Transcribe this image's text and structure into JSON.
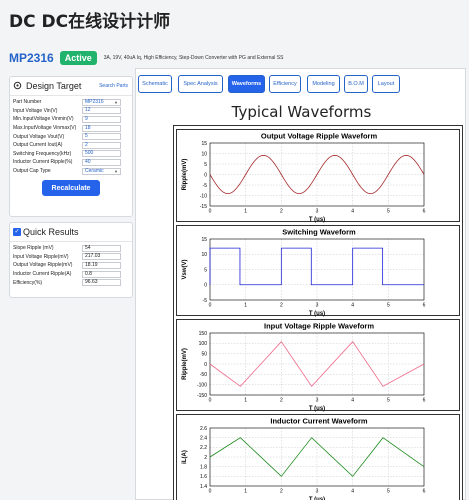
{
  "header": {
    "title": "DC DC在线设计计师"
  },
  "part": {
    "name": "MP2316",
    "status": "Active",
    "description": "3A, 19V, 40uA Iq, High Efficiency, Step-Down Converter with PG and External SS"
  },
  "design_target": {
    "title": "Design Target",
    "link": "Search Parts",
    "fields": [
      {
        "label": "Part Number",
        "value": "MP2316",
        "type": "select"
      },
      {
        "label": "Input Voltage Vin(V)",
        "value": "12",
        "type": "input"
      },
      {
        "label": "Min.InputVoltage Vinmin(V)",
        "value": "9",
        "type": "input"
      },
      {
        "label": "Max.InputVoltage Vinmax(V)",
        "value": "18",
        "type": "input"
      },
      {
        "label": "Output Voltage Vout(V)",
        "value": "5",
        "type": "input"
      },
      {
        "label": "Output Current Iout(A)",
        "value": "2",
        "type": "input"
      },
      {
        "label": "Switching Frequency(kHz)",
        "value": "500",
        "type": "input"
      },
      {
        "label": "Inductor Current Ripple(%)",
        "value": "40",
        "type": "input"
      },
      {
        "label": "Output Cap Type",
        "value": "Ceramic",
        "type": "select"
      }
    ],
    "button": "Recalculate"
  },
  "quick_results": {
    "title": "Quick Results",
    "checked": true,
    "fields": [
      {
        "label": "Slope Ripple (mV)",
        "value": "54"
      },
      {
        "label": "Input Voltage Ripple(mV)",
        "value": "217.03"
      },
      {
        "label": "Output Voltage Ripple(mV)",
        "value": "18.19"
      },
      {
        "label": "Inductor Current Ripple(A)",
        "value": "0.8"
      },
      {
        "label": "Efficiency(%)",
        "value": "96.63"
      }
    ]
  },
  "tabs": [
    {
      "label": "Schematic",
      "active": false
    },
    {
      "label": "Spec Analysis",
      "active": false
    },
    {
      "label": "Waveforms",
      "active": true
    },
    {
      "label": "Efficiency",
      "active": false
    },
    {
      "label": "Modeling",
      "active": false
    },
    {
      "label": "B.O.M",
      "active": false
    },
    {
      "label": "Layout",
      "active": false
    }
  ],
  "section_title": "Typical Waveforms",
  "chart_data": [
    {
      "type": "line",
      "title": "Output Voltage Ripple Waveform",
      "xlabel": "T (us)",
      "ylabel": "Ripple(mV)",
      "xlim": [
        0,
        6
      ],
      "ylim": [
        -15,
        15
      ],
      "xticks": [
        0,
        1,
        2,
        3,
        4,
        5,
        6
      ],
      "yticks": [
        15,
        10,
        5,
        0,
        -5,
        -10,
        -15
      ],
      "grid": true,
      "color": "#a52a2a",
      "series": [
        {
          "shape": "sine",
          "amplitude": 9.1,
          "period": 2,
          "phase_deg": 180
        }
      ]
    },
    {
      "type": "line",
      "title": "Switching Waveform",
      "xlabel": "T (us)",
      "ylabel": "Vsw(V)",
      "xlim": [
        0,
        6
      ],
      "ylim": [
        -5,
        15
      ],
      "xticks": [
        0,
        1,
        2,
        3,
        4,
        5,
        6
      ],
      "yticks": [
        15,
        10,
        5,
        0,
        -5
      ],
      "grid": true,
      "color": "#1e22d6",
      "series": [
        {
          "shape": "square",
          "high": 12,
          "low": 0,
          "period": 2,
          "duty": 0.42
        }
      ]
    },
    {
      "type": "line",
      "title": "Input Voltage Ripple Waveform",
      "xlabel": "T (us)",
      "ylabel": "Ripple(mV)",
      "xlim": [
        0,
        6
      ],
      "ylim": [
        -150,
        150
      ],
      "xticks": [
        0,
        1,
        2,
        3,
        4,
        5,
        6
      ],
      "yticks": [
        150,
        100,
        50,
        0,
        -50,
        -100,
        -150
      ],
      "grid": true,
      "color": "#f06a8a",
      "series": [
        {
          "shape": "triangle",
          "points": [
            [
              0,
              0
            ],
            [
              0.85,
              -108
            ],
            [
              2,
              108
            ],
            [
              2.85,
              -108
            ],
            [
              4,
              108
            ],
            [
              4.85,
              -108
            ],
            [
              6,
              0
            ]
          ]
        }
      ]
    },
    {
      "type": "line",
      "title": "Inductor Current Waveform",
      "xlabel": "T (us)",
      "ylabel": "iL(A)",
      "xlim": [
        0,
        6
      ],
      "ylim": [
        1.4,
        2.6
      ],
      "xticks": [
        0,
        1,
        2,
        3,
        4,
        5,
        6
      ],
      "yticks": [
        2.6,
        2.4,
        2.2,
        2.0,
        1.8,
        1.6,
        1.4
      ],
      "grid": true,
      "color": "#1c8a1c",
      "series": [
        {
          "shape": "triangle",
          "points": [
            [
              0,
              2.0
            ],
            [
              0.85,
              2.4
            ],
            [
              2,
              1.6
            ],
            [
              2.85,
              2.4
            ],
            [
              4,
              1.6
            ],
            [
              4.85,
              2.4
            ],
            [
              6,
              1.8
            ]
          ]
        }
      ]
    }
  ]
}
